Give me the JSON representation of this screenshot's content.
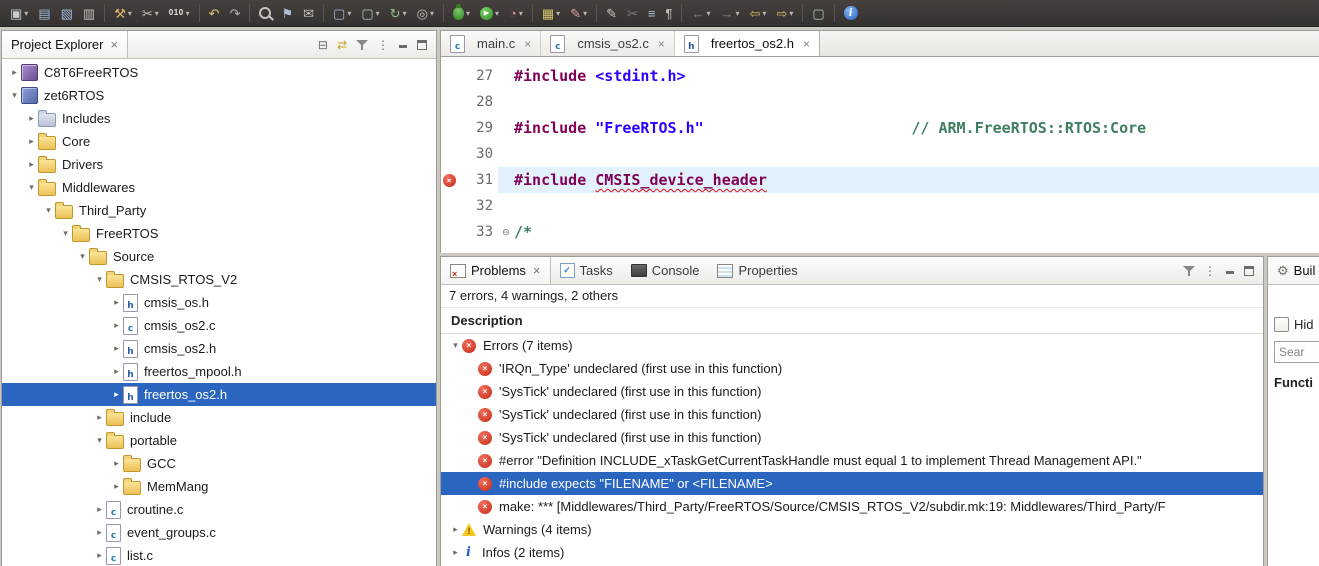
{
  "colors": {
    "selection_blue": "#2a66c0",
    "error_red": "#c22a17",
    "warning_yellow": "#f7c920",
    "toolbar_bg": "#3c3835",
    "keyword_purple": "#7f0055",
    "include_blue": "#2a00ff",
    "comment_green": "#3f7f5f",
    "current_line_blue": "#e3f1fd"
  },
  "glyphs": {
    "close": "×",
    "caret": "▾",
    "twistie_collapsed": "▸",
    "twistie_expanded": "▾",
    "fold_expanded": "⊖",
    "error_x": "×",
    "check": "✓",
    "gear": "⚙",
    "info_i": "i",
    "view_menu": "⋮",
    "collapse_all": "⊟",
    "link_editor": "⇄",
    "play": "▶",
    "warning_mark": "!"
  },
  "toolbar": {
    "icons": [
      {
        "name": "new-wizard-icon",
        "glyph": "▣",
        "color": "#c9ccd4",
        "dropdown": true
      },
      {
        "name": "save-icon",
        "glyph": "▤",
        "color": "#9fb7d8"
      },
      {
        "name": "save-all-icon",
        "glyph": "▧",
        "color": "#9fb7d8"
      },
      {
        "name": "print-icon",
        "glyph": "▥",
        "color": "#c6c2bd"
      },
      {
        "sep": true
      },
      {
        "name": "build-icon",
        "glyph": "⚒",
        "color": "#d8b46a",
        "dropdown": true
      },
      {
        "name": "knife-tool-icon",
        "glyph": "✂",
        "color": "#c6c2bd",
        "dropdown": true
      },
      {
        "name": "binary-file-icon",
        "glyph": "010",
        "color": "#e8e4df",
        "text": true,
        "dropdown": true
      },
      {
        "sep": true
      },
      {
        "name": "undo-icon",
        "glyph": "↶",
        "color": "#d9c97a"
      },
      {
        "name": "redo-icon",
        "glyph": "↷",
        "color": "#b5b1ac"
      },
      {
        "sep": true
      },
      {
        "name": "search-icon",
        "special": "magnifier"
      },
      {
        "name": "bookmark-icon",
        "glyph": "⚑",
        "color": "#a8c0dc"
      },
      {
        "name": "task-mail-icon",
        "glyph": "✉",
        "color": "#c6c2bd"
      },
      {
        "sep": true
      },
      {
        "name": "new-source-file-icon",
        "glyph": "▢",
        "color": "#9fb7d8",
        "dropdown": true
      },
      {
        "name": "new-class-icon",
        "glyph": "▢",
        "color": "#a8d0a8",
        "dropdown": true
      },
      {
        "name": "coverage-icon",
        "glyph": "↻",
        "color": "#8fbf8f",
        "dropdown": true
      },
      {
        "name": "external-tools-icon",
        "glyph": "◎",
        "color": "#c6c2bd",
        "dropdown": true
      },
      {
        "sep": true
      },
      {
        "name": "debug-icon",
        "special": "bug",
        "dropdown": true
      },
      {
        "name": "run-icon",
        "special": "run",
        "dropdown": true
      },
      {
        "name": "profile-icon",
        "glyph": "◔",
        "color": "#c98f8f",
        "dropdown": true
      },
      {
        "sep": true
      },
      {
        "name": "open-perspective-icon",
        "glyph": "▦",
        "color": "#d8c46a",
        "dropdown": true
      },
      {
        "name": "annotate-icon",
        "glyph": "✎",
        "color": "#d8a0a0",
        "dropdown": true
      },
      {
        "sep": true
      },
      {
        "name": "pencil-icon",
        "glyph": "✎",
        "color": "#c6c2bd"
      },
      {
        "name": "cut-icon",
        "glyph": "✂",
        "color": "#7f7b77"
      },
      {
        "name": "outline-icon",
        "glyph": "≡",
        "color": "#a8c0dc"
      },
      {
        "name": "show-whitespace-icon",
        "glyph": "¶",
        "color": "#c6c2bd"
      },
      {
        "sep": true
      },
      {
        "name": "previous-annotation-icon",
        "glyph": "←",
        "color": "#8a8682",
        "dropdown": true
      },
      {
        "name": "next-annotation-icon",
        "glyph": "→",
        "color": "#8a8682",
        "dropdown": true
      },
      {
        "name": "back-icon",
        "glyph": "⇦",
        "color": "#d8b46a",
        "dropdown": true
      },
      {
        "name": "forward-icon",
        "glyph": "⇨",
        "color": "#d8b46a",
        "dropdown": true
      },
      {
        "sep": true
      },
      {
        "name": "last-edit-location-icon",
        "glyph": "▢",
        "color": "#a8d0a8"
      },
      {
        "sep": true
      },
      {
        "name": "info-icon",
        "special": "info"
      }
    ]
  },
  "project_explorer": {
    "tab": {
      "label": "Project Explorer"
    },
    "header_icons": [
      {
        "name": "collapse-all-icon",
        "kind": "collapse-all"
      },
      {
        "name": "link-with-editor-icon",
        "kind": "link"
      },
      {
        "name": "filter-icon",
        "kind": "funnel"
      },
      {
        "name": "view-menu-icon",
        "kind": "view-menu"
      },
      {
        "name": "minimize-icon",
        "kind": "min"
      },
      {
        "name": "maximize-icon",
        "kind": "max"
      }
    ],
    "tree": [
      {
        "label": "C8T6FreeRTOS",
        "depth": 0,
        "twistie": "collapsed",
        "icon": "project-ide"
      },
      {
        "label": "zet6RTOS",
        "depth": 0,
        "twistie": "expanded",
        "icon": "project-mcu"
      },
      {
        "label": "Includes",
        "depth": 1,
        "twistie": "collapsed",
        "icon": "includes"
      },
      {
        "label": "Core",
        "depth": 1,
        "twistie": "collapsed",
        "icon": "folder"
      },
      {
        "label": "Drivers",
        "depth": 1,
        "twistie": "collapsed",
        "icon": "folder"
      },
      {
        "label": "Middlewares",
        "depth": 1,
        "twistie": "expanded",
        "icon": "folder"
      },
      {
        "label": "Third_Party",
        "depth": 2,
        "twistie": "expanded",
        "icon": "folder"
      },
      {
        "label": "FreeRTOS",
        "depth": 3,
        "twistie": "expanded",
        "icon": "folder"
      },
      {
        "label": "Source",
        "depth": 4,
        "twistie": "expanded",
        "icon": "folder"
      },
      {
        "label": "CMSIS_RTOS_V2",
        "depth": 5,
        "twistie": "expanded",
        "icon": "folder"
      },
      {
        "label": "cmsis_os.h",
        "depth": 6,
        "twistie": "collapsed",
        "icon": "file-h"
      },
      {
        "label": "cmsis_os2.c",
        "depth": 6,
        "twistie": "collapsed",
        "icon": "file-c"
      },
      {
        "label": "cmsis_os2.h",
        "depth": 6,
        "twistie": "collapsed",
        "icon": "file-h"
      },
      {
        "label": "freertos_mpool.h",
        "depth": 6,
        "twistie": "collapsed",
        "icon": "file-h"
      },
      {
        "label": "freertos_os2.h",
        "depth": 6,
        "twistie": "collapsed",
        "icon": "file-h",
        "selected": true
      },
      {
        "label": "include",
        "depth": 5,
        "twistie": "collapsed",
        "icon": "folder"
      },
      {
        "label": "portable",
        "depth": 5,
        "twistie": "expanded",
        "icon": "folder"
      },
      {
        "label": "GCC",
        "depth": 6,
        "twistie": "collapsed",
        "icon": "folder"
      },
      {
        "label": "MemMang",
        "depth": 6,
        "twistie": "collapsed",
        "icon": "folder"
      },
      {
        "label": "croutine.c",
        "depth": 5,
        "twistie": "collapsed",
        "icon": "file-c"
      },
      {
        "label": "event_groups.c",
        "depth": 5,
        "twistie": "collapsed",
        "icon": "file-c"
      },
      {
        "label": "list.c",
        "depth": 5,
        "twistie": "collapsed",
        "icon": "file-c"
      }
    ]
  },
  "editor": {
    "tabs": [
      {
        "label": "main.c",
        "icon": "file-c",
        "active": false
      },
      {
        "label": "cmsis_os2.c",
        "icon": "file-c",
        "active": false
      },
      {
        "label": "freertos_os2.h",
        "icon": "file-h",
        "active": true
      }
    ],
    "lines": [
      {
        "num": "27",
        "segments": [
          {
            "text": "#include",
            "style": "directive"
          },
          {
            "text": " ",
            "style": "plain"
          },
          {
            "text": "<stdint.h>",
            "style": "include"
          }
        ]
      },
      {
        "num": "28",
        "segments": []
      },
      {
        "num": "29",
        "segments": [
          {
            "text": "#include",
            "style": "directive"
          },
          {
            "text": " ",
            "style": "plain"
          },
          {
            "text": "\"FreeRTOS.h\"",
            "style": "include"
          },
          {
            "text": "                       ",
            "style": "plain"
          },
          {
            "text": "// ARM.FreeRTOS::RTOS:Core",
            "style": "comment"
          }
        ]
      },
      {
        "num": "30",
        "segments": []
      },
      {
        "num": "31",
        "highlight": true,
        "error_marker": true,
        "segments": [
          {
            "text": "#include",
            "style": "directive"
          },
          {
            "text": " ",
            "style": "plain"
          },
          {
            "text": "CMSIS_device_header",
            "style": "error-token"
          }
        ]
      },
      {
        "num": "32",
        "segments": []
      },
      {
        "num": "33",
        "fold": "expanded",
        "segments": [
          {
            "text": "/*",
            "style": "comment"
          }
        ]
      }
    ]
  },
  "problems": {
    "tabs": [
      {
        "label": "Problems",
        "icon": "problems",
        "active": true,
        "closable": true
      },
      {
        "label": "Tasks",
        "icon": "tasks"
      },
      {
        "label": "Console",
        "icon": "console"
      },
      {
        "label": "Properties",
        "icon": "properties"
      }
    ],
    "toolbar_icons": [
      {
        "name": "filter-icon",
        "kind": "funnel"
      },
      {
        "name": "view-menu-icon",
        "kind": "view-menu"
      },
      {
        "name": "minimize-icon",
        "kind": "min"
      },
      {
        "name": "maximize-icon",
        "kind": "max"
      }
    ],
    "summary": "7 errors, 4 warnings, 2 others",
    "column_header": "Description",
    "rows": [
      {
        "label": "Errors (7 items)",
        "depth": 0,
        "twistie": "expanded",
        "icon": "error"
      },
      {
        "label": "'IRQn_Type' undeclared (first use in this function)",
        "depth": 1,
        "icon": "error"
      },
      {
        "label": "'SysTick' undeclared (first use in this function)",
        "depth": 1,
        "icon": "error"
      },
      {
        "label": "'SysTick' undeclared (first use in this function)",
        "depth": 1,
        "icon": "error"
      },
      {
        "label": "'SysTick' undeclared (first use in this function)",
        "depth": 1,
        "icon": "error"
      },
      {
        "label": "#error \"Definition INCLUDE_xTaskGetCurrentTaskHandle must equal 1 to implement Thread Management API.\"",
        "depth": 1,
        "icon": "error"
      },
      {
        "label": "#include expects \"FILENAME\" or <FILENAME>",
        "depth": 1,
        "icon": "error",
        "selected": true
      },
      {
        "label": "make: *** [Middlewares/Third_Party/FreeRTOS/Source/CMSIS_RTOS_V2/subdir.mk:19: Middlewares/Third_Party/F",
        "depth": 1,
        "icon": "error"
      },
      {
        "label": "Warnings (4 items)",
        "depth": 0,
        "twistie": "collapsed",
        "icon": "warning"
      },
      {
        "label": "Infos (2 items)",
        "depth": 0,
        "twistie": "collapsed",
        "icon": "info"
      }
    ]
  },
  "build_panel": {
    "tab_label": "Buil",
    "hide_label": "Hid",
    "search_placeholder": "Sear",
    "function_header": "Functi"
  }
}
